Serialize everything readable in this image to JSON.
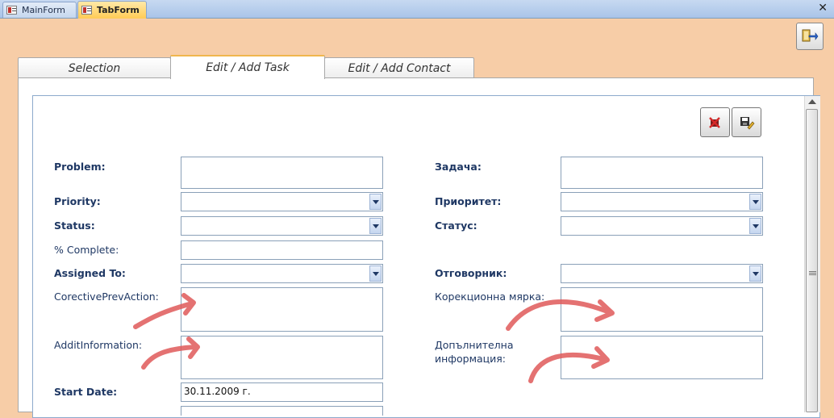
{
  "doc_tabs": [
    {
      "label": "MainForm"
    },
    {
      "label": "TabForm"
    }
  ],
  "form_tabs": [
    {
      "label": "Selection"
    },
    {
      "label": "Edit / Add Task"
    },
    {
      "label": "Edit / Add Contact"
    }
  ],
  "left_fields": {
    "problem": {
      "label": "Problem:",
      "value": ""
    },
    "priority": {
      "label": "Priority:",
      "value": ""
    },
    "status": {
      "label": "Status:",
      "value": ""
    },
    "complete": {
      "label": "% Complete:",
      "value": ""
    },
    "assigned": {
      "label": "Assigned To:",
      "value": ""
    },
    "corrective": {
      "label": "CorectivePrevAction:",
      "value": ""
    },
    "additinfo": {
      "label": "AdditInformation:",
      "value": ""
    },
    "start_date": {
      "label": "Start Date:",
      "value": "30.11.2009 г."
    }
  },
  "right_fields": {
    "zadacha": {
      "label": "Задача:",
      "value": ""
    },
    "prioritet": {
      "label": "Приоритет:",
      "value": ""
    },
    "status": {
      "label": "Статус:",
      "value": ""
    },
    "otgovornik": {
      "label": "Отговорник:",
      "value": ""
    },
    "korekcionna": {
      "label": "Корекционна мярка:",
      "value": ""
    },
    "dopulnitelna_1": "Допълнителна",
    "dopulnitelna_2": "информация:"
  },
  "colors": {
    "background": "#f7cda7",
    "active_tab_accent": "#f0b64d",
    "label": "#1f3864",
    "annotation_arrow": "#e05a5a"
  },
  "icons": [
    "form-icon",
    "close-icon",
    "exit-form-icon",
    "undo-delete-icon",
    "save-edit-icon",
    "dropdown-arrow-icon"
  ]
}
